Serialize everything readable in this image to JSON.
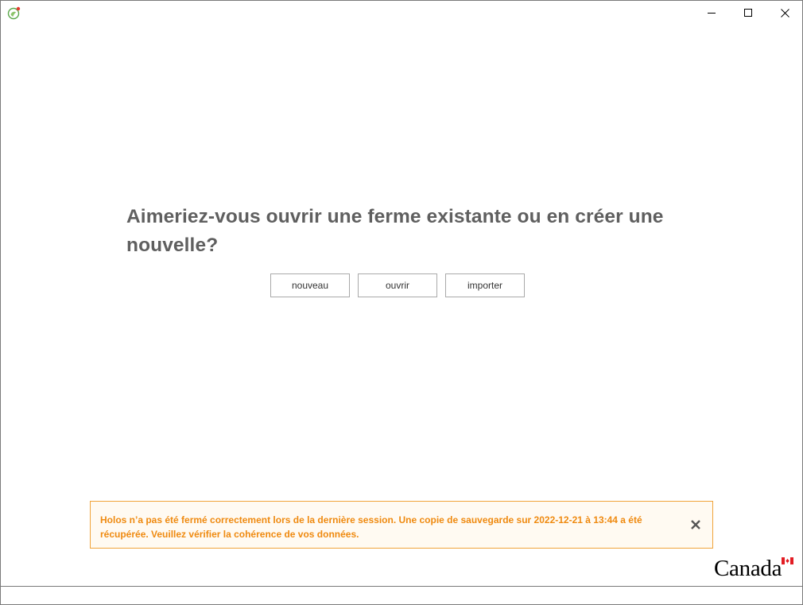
{
  "window": {
    "app_icon": "holos-leaf-icon",
    "controls": {
      "minimize_icon": "minimize-icon",
      "maximize_icon": "maximize-icon",
      "close_icon": "close-icon"
    }
  },
  "main": {
    "question": "Aimeriez-vous ouvrir une ferme existante ou en créer une nouvelle?",
    "buttons": {
      "new_label": "nouveau",
      "open_label": "ouvrir",
      "import_label": "importer"
    }
  },
  "notification": {
    "message": "Holos n’a pas été fermé correctement lors de la dernière session.  Une copie de sauvegarde sur 2022-12-21 à 13:44 a été récupérée. Veuillez vérifier la cohérence de vos données.",
    "close_icon": "close-x-icon",
    "color": "#ef8a10"
  },
  "branding": {
    "wordmark": "Canada",
    "flag_icon": "canada-flag-icon"
  },
  "colors": {
    "question_text": "#5f5f5f",
    "notice_border": "#f0a33a",
    "flag_red": "#e21c23"
  }
}
